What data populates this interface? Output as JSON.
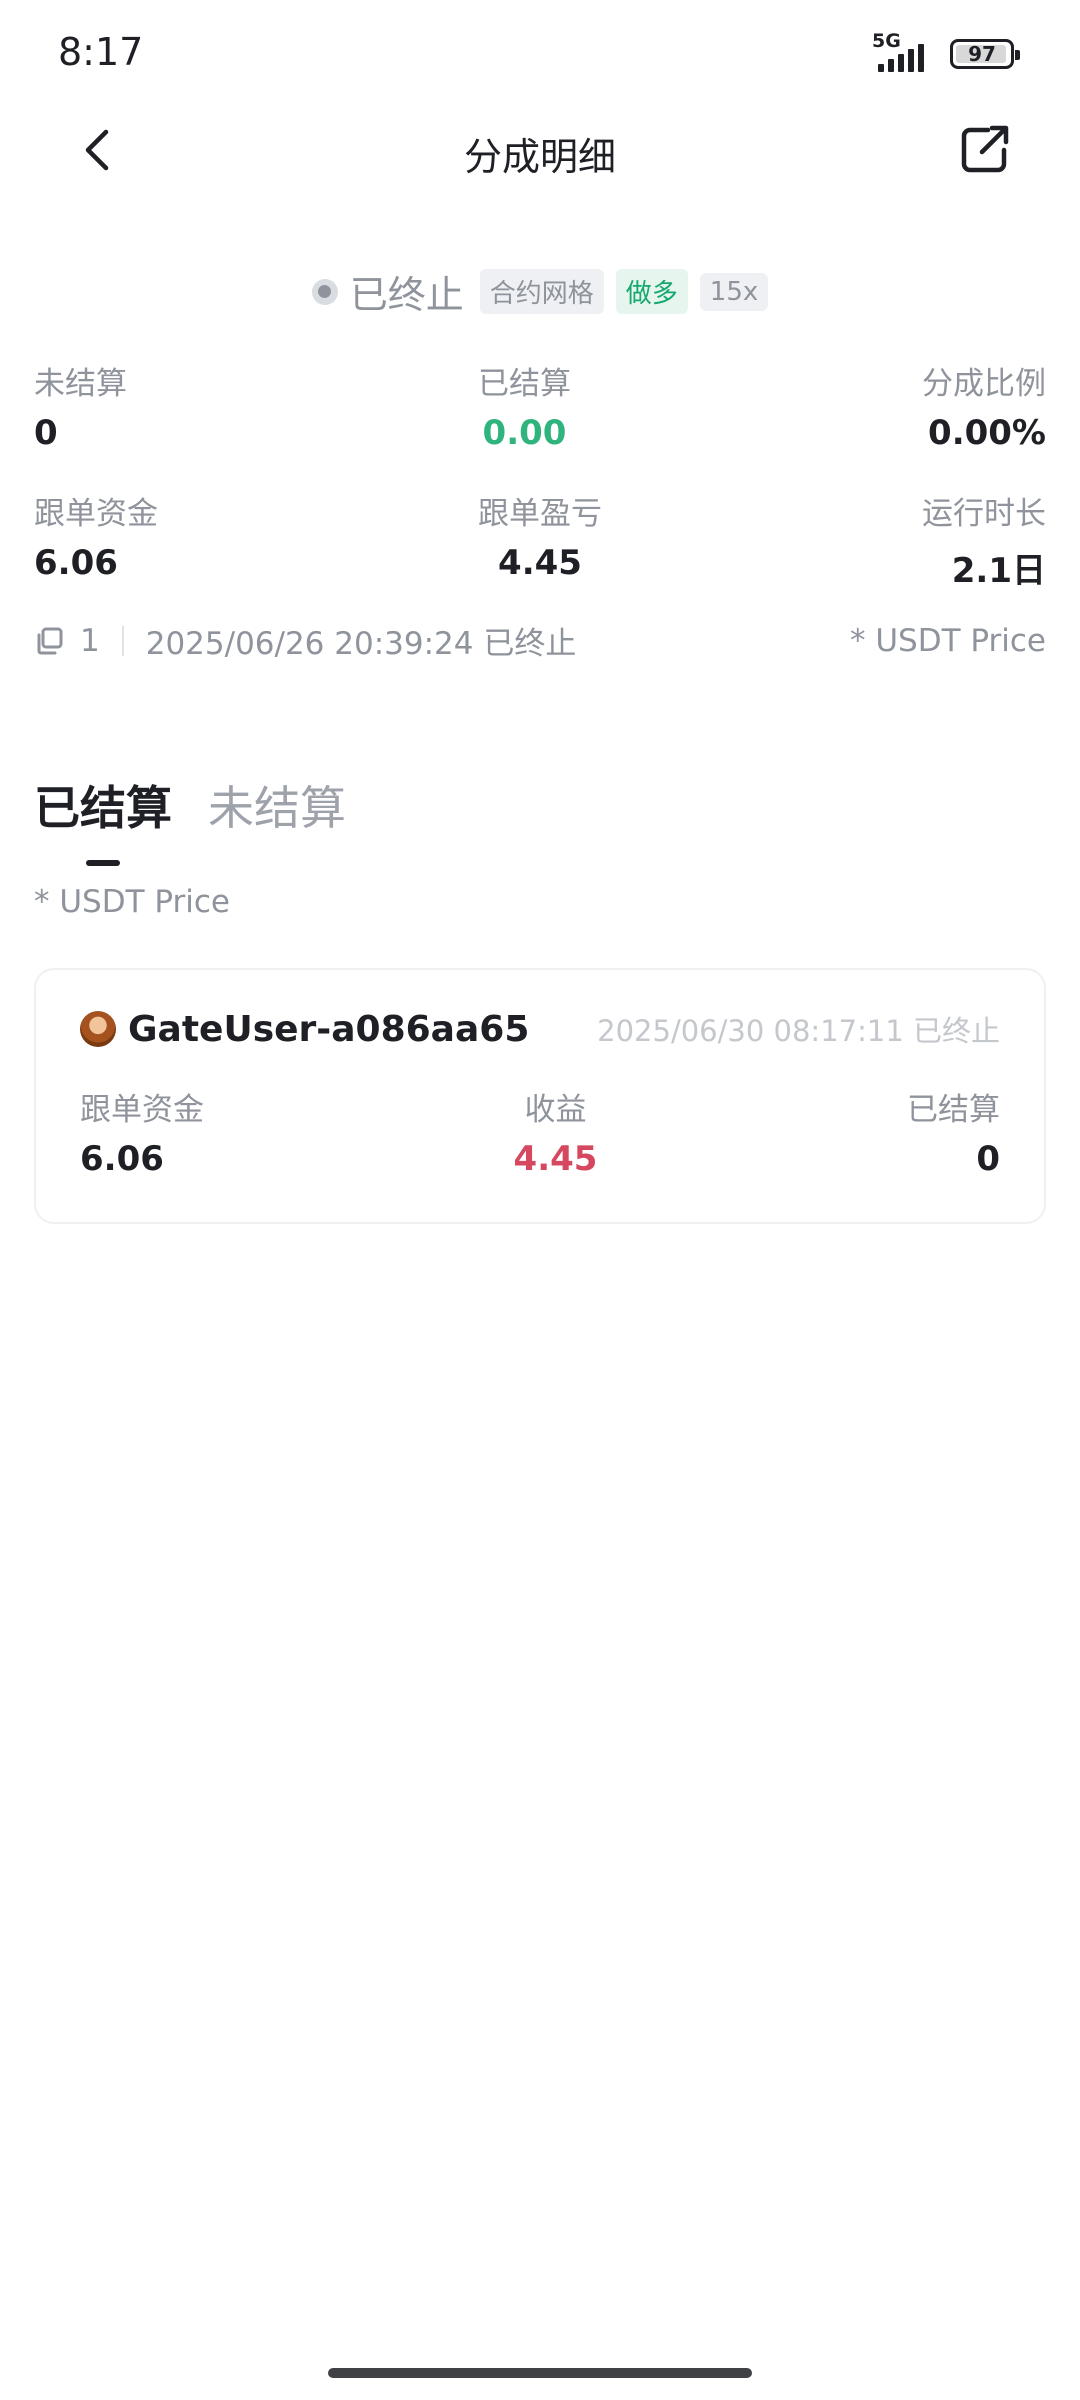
{
  "status_bar": {
    "time": "8:17",
    "network": "5G",
    "battery": "97",
    "battery_level": 0.97
  },
  "nav": {
    "title": "分成明细"
  },
  "status": {
    "text": "已终止",
    "tags": [
      "合约网格",
      "做多",
      "15x"
    ]
  },
  "stats_row1": [
    {
      "label": "未结算",
      "value": "0"
    },
    {
      "label": "已结算",
      "value": "0.00"
    },
    {
      "label": "分成比例",
      "value": "0.00%"
    }
  ],
  "stats_row2": [
    {
      "label": "跟单资金",
      "value": "6.06"
    },
    {
      "label": "跟单盈亏",
      "value": "4.45"
    },
    {
      "label": "运行时长",
      "value": "2.1日"
    }
  ],
  "meta": {
    "count": "1",
    "datetime": "2025/06/26 20:39:24 已终止",
    "price_note": "* USDT Price"
  },
  "tabs": [
    {
      "label": "已结算"
    },
    {
      "label": "未结算"
    }
  ],
  "price_note": "* USDT Price",
  "record": {
    "user": "GateUser-a086aa65",
    "time": "2025/06/30 08:17:11 已终止",
    "stats": [
      {
        "label": "跟单资金",
        "value": "6.06"
      },
      {
        "label": "收益",
        "value": "4.45"
      },
      {
        "label": "已结算",
        "value": "0"
      }
    ]
  },
  "colors": {
    "positive": "#2fb47e",
    "profit": "#d5485f",
    "long_tag": "#17a86f"
  },
  "icons": {
    "back": "chevron-left-icon",
    "share": "share-icon",
    "copy": "copy-icon",
    "status": "status-dot-icon"
  }
}
